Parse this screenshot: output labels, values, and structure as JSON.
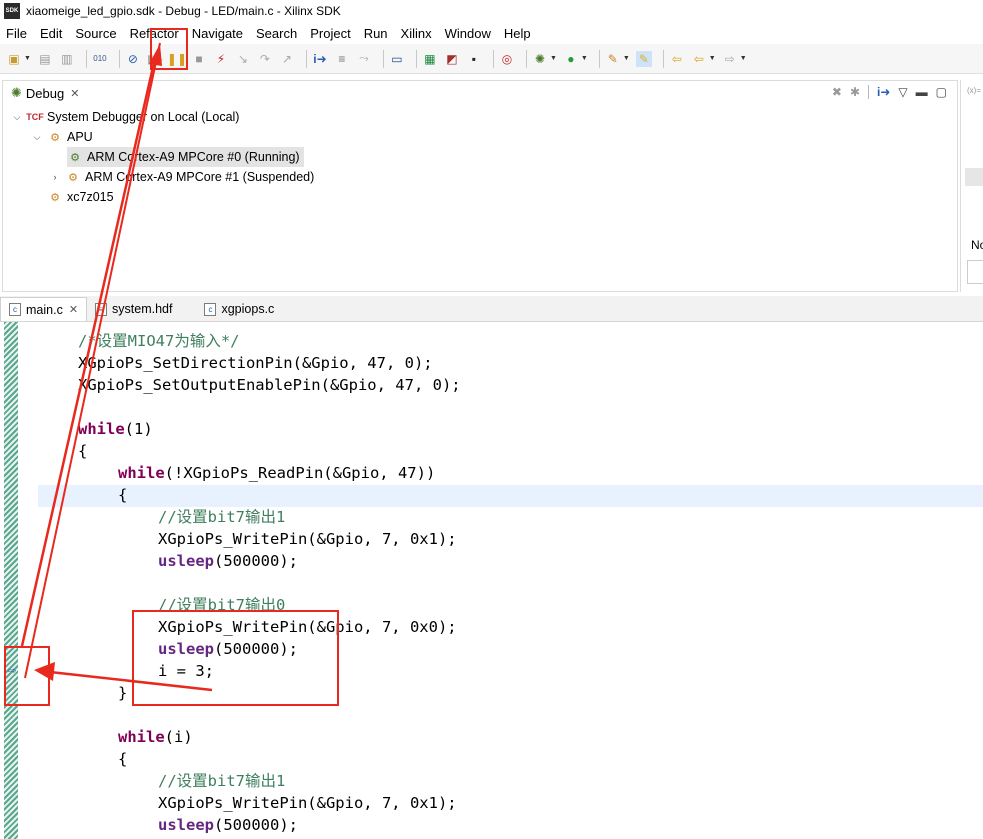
{
  "window": {
    "title": "xiaomeige_led_gpio.sdk - Debug - LED/main.c - Xilinx SDK",
    "app_icon_text": "SDK"
  },
  "menu": [
    "File",
    "Edit",
    "Source",
    "Refactor",
    "Navigate",
    "Search",
    "Project",
    "Run",
    "Xilinx",
    "Window",
    "Help"
  ],
  "debug_view": {
    "tab_label": "Debug",
    "tree": [
      {
        "label": "System Debugger on Local (Local)",
        "icon": "tcf-icon"
      },
      {
        "label": "APU",
        "icon": "processor-group-icon"
      },
      {
        "label": "ARM Cortex-A9 MPCore #0 (Running)",
        "icon": "running-thread-icon",
        "selected": true
      },
      {
        "label": "ARM Cortex-A9 MPCore #1 (Suspended)",
        "icon": "suspended-thread-icon"
      },
      {
        "label": "xc7z015",
        "icon": "device-icon"
      }
    ]
  },
  "right_panel": {
    "partial_label": "No"
  },
  "editor_tabs": [
    {
      "label": "main.c",
      "active": true
    },
    {
      "label": "system.hdf",
      "active": false
    },
    {
      "label": "xgpiops.c",
      "active": false
    }
  ],
  "code": {
    "l01": "/*设置MIO47为输入*/",
    "l02": "XGpioPs_SetDirectionPin(&Gpio, 47, 0);",
    "l03": "XGpioPs_SetOutputEnablePin(&Gpio, 47, 0);",
    "l05a": "while",
    "l05b": "(1)",
    "l06": "{",
    "l07a": "while",
    "l07b": "(!XGpioPs_ReadPin(&Gpio, 47))",
    "l08": "{",
    "l09": "//设置bit7输出1",
    "l10": "XGpioPs_WritePin(&Gpio, 7, 0x1);",
    "l11a": "usleep",
    "l11b": "(500000);",
    "l13": "//设置bit7输出0",
    "l14": "XGpioPs_WritePin(&Gpio, 7, 0x0);",
    "l15a": "usleep",
    "l15b": "(500000);",
    "l16": "i = 3;",
    "l17": "}",
    "l19a": "while",
    "l19b": "(i)",
    "l20": "{",
    "l21": "//设置bit7输出1",
    "l22": "XGpioPs_WritePin(&Gpio, 7, 0x1);",
    "l23a": "usleep",
    "l23b": "(500000);"
  },
  "colors": {
    "annotation_red": "#e8291d",
    "keyword": "#7f0055",
    "comment": "#3f7f5f",
    "current_line": "#e8f2fe"
  }
}
